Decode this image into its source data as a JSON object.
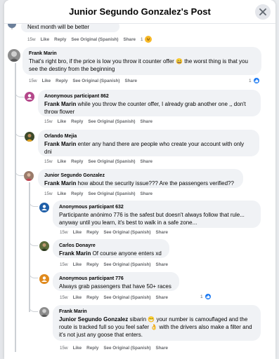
{
  "modal": {
    "title": "Junior Segundo Gonzalez's Post",
    "close_label": "Close"
  },
  "actions": {
    "like": "Like",
    "reply": "Reply",
    "see_original": "See Original (Spanish)",
    "share": "Share"
  },
  "colors": {
    "bubble": "#f0f2f5",
    "text": "#050505",
    "meta": "#65676b",
    "like_blue": "#1877f2"
  },
  "comments": [
    {
      "id": "c0",
      "author": "",
      "mention": "",
      "text": "Next month will be better",
      "time": "15w",
      "reaction_icon": "haha-emoji",
      "reaction_count": "1"
    },
    {
      "id": "c1",
      "author": "Frank Marin",
      "mention": "",
      "text": "That's right bro, if the price is low you throw it counter offer 😀 the worst thing is that you see the destiny from the beginning",
      "time": "15w",
      "reaction_icon": "like-icon",
      "reaction_count": "1"
    },
    {
      "id": "c2",
      "author": "Anonymous participant 862",
      "mention": "Frank Marin",
      "text": "while you throw the counter offer, I already grab another one ,, don't throw flower",
      "time": "15w"
    },
    {
      "id": "c3",
      "author": "Orlando Mejia",
      "mention": "Frank Marin",
      "text": "enter any hand there are people who create your account with only dni",
      "time": "15w"
    },
    {
      "id": "c4",
      "author": "Junior Segundo Gonzalez",
      "mention": "Frank Marin",
      "text": "how about the security issue??? Are the passengers verified??",
      "time": "15w"
    },
    {
      "id": "c5",
      "author": "Anonymous participant 632",
      "mention": "",
      "text": "Participante anónimo 776 is the safest but doesn't always follow that rule... anyway until you learn, it's best to walk in a safe zone...",
      "time": "15w"
    },
    {
      "id": "c6",
      "author": "Carlos Donayre",
      "mention": "Frank Marin",
      "text": "Of course anyone enters xd",
      "time": "15w"
    },
    {
      "id": "c7",
      "author": "Anonymous participant 776",
      "mention": "",
      "text": "Always grab passengers that have 50+ races",
      "time": "15w",
      "reaction_icon": "like-icon",
      "reaction_count": "1"
    },
    {
      "id": "c8",
      "author": "Frank Marin",
      "mention": "Junior Segundo Gonzalez",
      "text": "sibarin 😁 your number is camouflaged and the route is tracked full so you feel safer 👌 with the drivers also make a filter and it's not just any goose that enters.",
      "time": "15w"
    }
  ]
}
